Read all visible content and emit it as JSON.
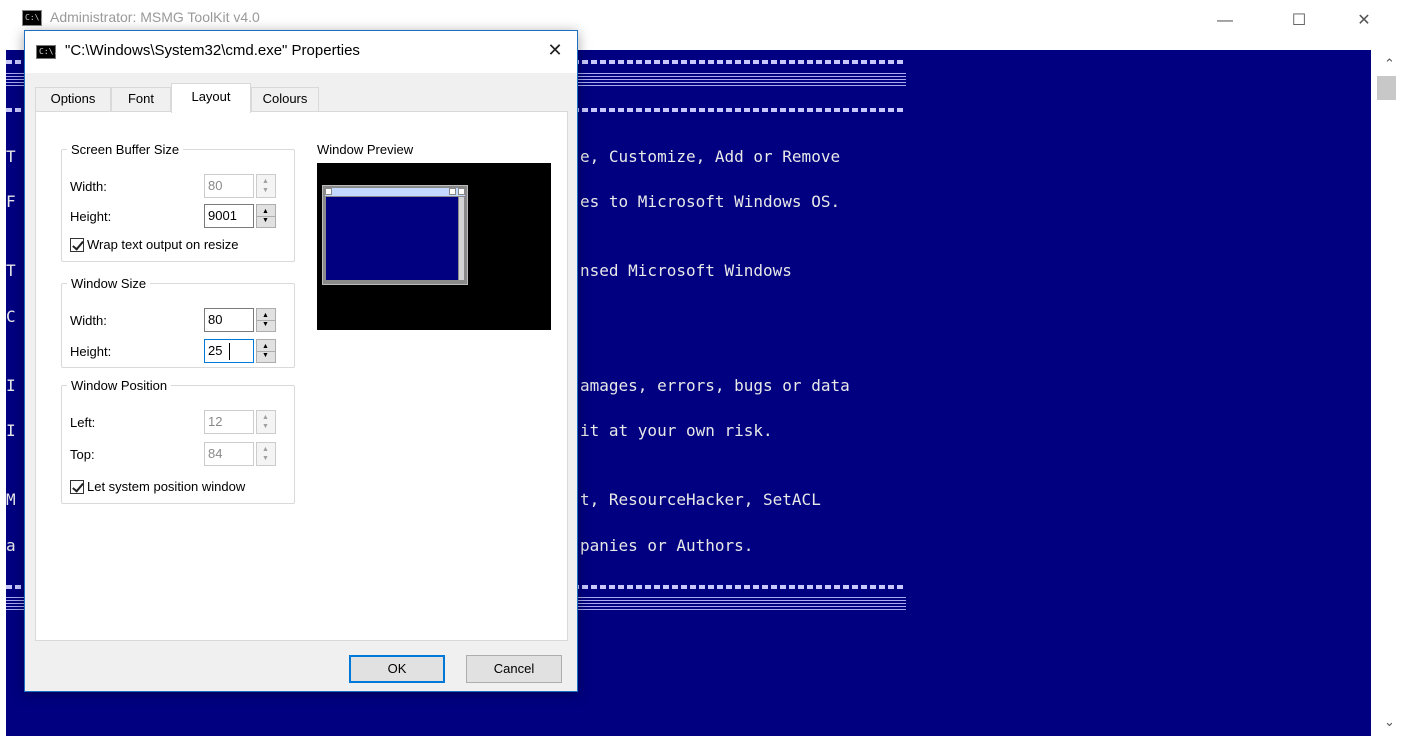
{
  "console": {
    "title": "Administrator:  MSMG ToolKit v4.0",
    "icon_text": "C:\\.",
    "controls": {
      "minimize": "—",
      "maximize": "☐",
      "close": "✕"
    },
    "lines": [
      "e, Customize, Add or Remove",
      "es to Microsoft Windows OS.",
      "nsed Microsoft Windows",
      "amages, errors, bugs or data",
      "it at your own risk.",
      "t, ResourceHacker, SetACL",
      "panies or Authors."
    ],
    "partial_line_starts": [
      "T",
      "F",
      "T",
      "C",
      "I",
      "I",
      "M",
      "a"
    ],
    "scroll_up": "⌃",
    "scroll_down": "⌄",
    "colors": {
      "background": "#000080",
      "text": "#e8e8e8"
    }
  },
  "dialog": {
    "title": "\"C:\\Windows\\System32\\cmd.exe\" Properties",
    "icon_text": "C:\\.",
    "close": "✕",
    "tabs": [
      "Options",
      "Font",
      "Layout",
      "Colours"
    ],
    "active_tab": "Layout",
    "screen_buffer": {
      "legend": "Screen Buffer Size",
      "width_label": "Width:",
      "width_value": "80",
      "height_label": "Height:",
      "height_value": "9001",
      "wrap_label": "Wrap text output on resize",
      "wrap_checked": true
    },
    "window_size": {
      "legend": "Window Size",
      "width_label": "Width:",
      "width_value": "80",
      "height_label": "Height:",
      "height_value": "25"
    },
    "window_position": {
      "legend": "Window Position",
      "left_label": "Left:",
      "left_value": "12",
      "top_label": "Top:",
      "top_value": "84",
      "let_system_label": "Let system position window",
      "let_system_checked": true
    },
    "preview_label": "Window Preview",
    "ok": "OK",
    "cancel": "Cancel"
  }
}
